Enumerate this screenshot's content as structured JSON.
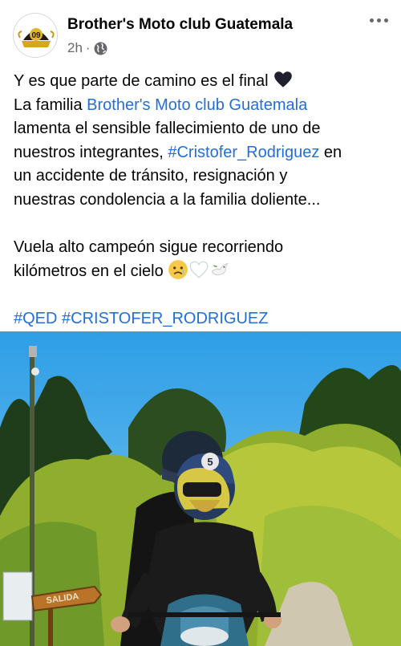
{
  "header": {
    "page_name": "Brother's Moto club Guatemala",
    "time": "2h",
    "separator": "·",
    "avatar_year": "09"
  },
  "post": {
    "line1": "Y es que parte de camino es el final",
    "line2_prefix": "La familia ",
    "line2_link": "Brother's Moto club Guatemala",
    "line3": "lamenta el sensible fallecimiento de uno de",
    "line4_prefix": "nuestros integrantes, ",
    "line4_hashtag": "#Cristofer_Rodriguez",
    "line4_suffix": " en",
    "line5": "un accidente de tránsito, resignación y",
    "line6": "nuestras condolencia a la familia doliente...",
    "line7": "Vuela alto campeón sigue recorriendo",
    "line8": "kilómetros en el cielo",
    "hashtag1": "#QED",
    "hashtag2": "#CRISTOFER_RODRIGUEZ"
  },
  "photo": {
    "helmet_number": "5",
    "sign_text": "SALIDA"
  },
  "icons": [
    "globe-icon",
    "more-options-icon",
    "black-heart-icon",
    "sad-face-icon",
    "white-heart-icon",
    "dove-icon"
  ]
}
